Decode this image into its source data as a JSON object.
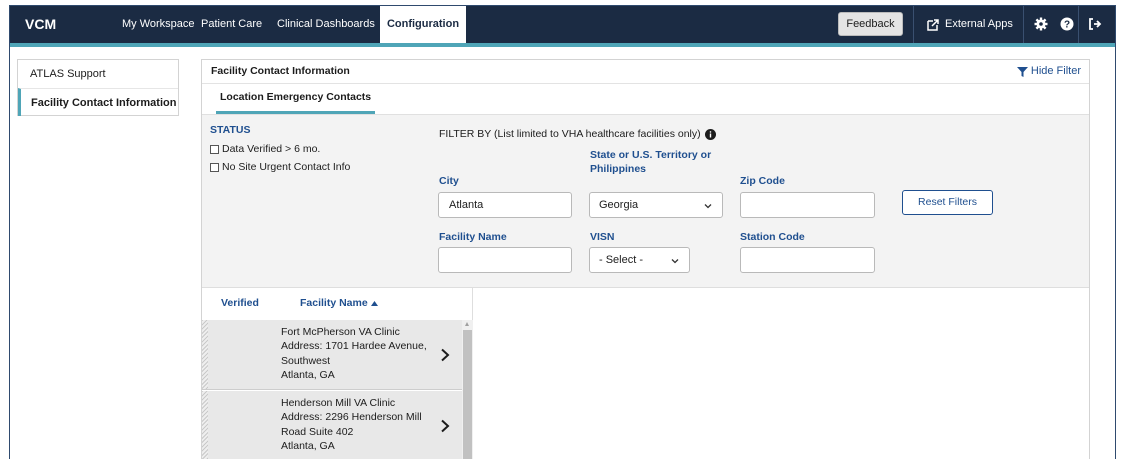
{
  "app": {
    "brand": "VCM"
  },
  "nav": {
    "items": [
      {
        "label": "My Workspace"
      },
      {
        "label": "Patient Care"
      },
      {
        "label": "Clinical Dashboards"
      },
      {
        "label": "Configuration",
        "active": true
      }
    ],
    "feedback_label": "Feedback",
    "external_apps_label": "External Apps",
    "icons": [
      "settings-icon",
      "help-icon",
      "logout-icon"
    ]
  },
  "sidebar": {
    "items": [
      {
        "label": "ATLAS Support"
      },
      {
        "label": "Facility Contact Information",
        "active": true
      }
    ]
  },
  "main": {
    "title": "Facility Contact Information",
    "hide_filter_label": "Hide Filter",
    "tab_label": "Location Emergency Contacts"
  },
  "filters": {
    "status_title": "STATUS",
    "checkboxes": [
      {
        "label": "Data Verified > 6 mo.",
        "checked": false
      },
      {
        "label": "No Site Urgent Contact Info",
        "checked": false
      }
    ],
    "filter_by_label": "FILTER BY (List limited to VHA healthcare facilities only)",
    "city": {
      "label": "City",
      "value": "Atlanta"
    },
    "state": {
      "label_line1": "State or U.S. Territory or",
      "label_line2": "Philippines",
      "value": "Georgia"
    },
    "zip": {
      "label": "Zip Code",
      "value": ""
    },
    "facility_name": {
      "label": "Facility Name",
      "value": ""
    },
    "visn": {
      "label": "VISN",
      "value": "- Select -"
    },
    "station_code": {
      "label": "Station Code",
      "value": ""
    },
    "reset_label": "Reset Filters"
  },
  "results": {
    "columns": {
      "verified": "Verified",
      "facility": "Facility Name"
    },
    "rows": [
      {
        "name": "Fort McPherson VA Clinic",
        "address_line1": "Address: 1701 Hardee Avenue,",
        "address_line2": "Southwest",
        "city_state": "Atlanta, GA"
      },
      {
        "name": "Henderson Mill VA Clinic",
        "address_line1": "Address: 2296 Henderson Mill",
        "address_line2": "Road Suite 402",
        "city_state": "Atlanta, GA"
      }
    ]
  },
  "colors": {
    "header_bg": "#1b2b43",
    "accent": "#4fa5b7",
    "label_blue": "#1f4f8f"
  }
}
